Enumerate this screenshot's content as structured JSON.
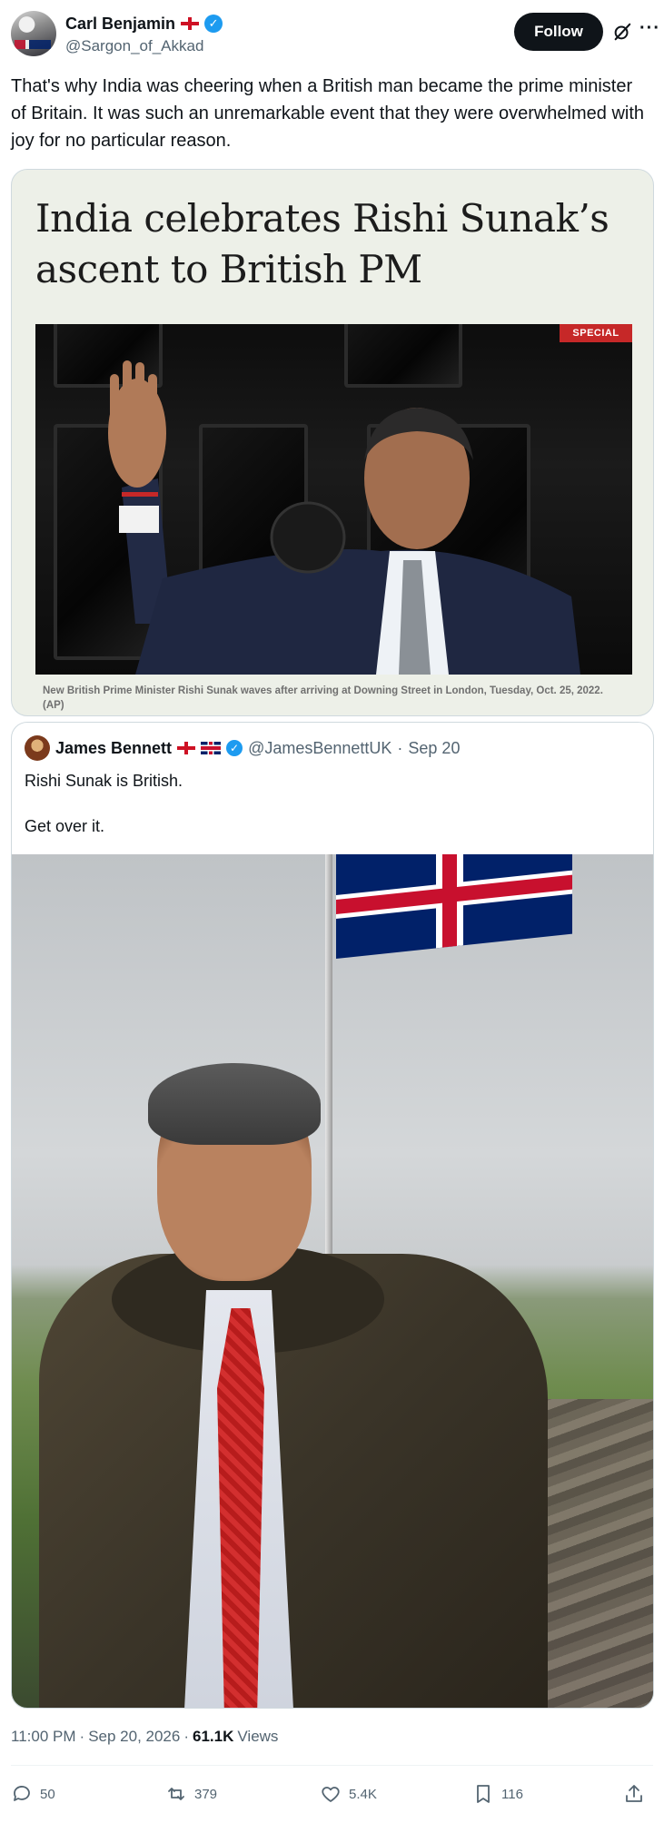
{
  "author": {
    "display_name": "Carl Benjamin",
    "handle": "@Sargon_of_Akkad",
    "verified": true
  },
  "header": {
    "follow_label": "Follow"
  },
  "tweet": {
    "text": "That's why India was cheering when a British man became the prime minister of Britain. It was such an unremarkable event that they were overwhelmed with joy for no particular reason."
  },
  "image_card": {
    "headline": "India celebrates Rishi Sunak’s ascent to British PM",
    "badge": "SPECIAL",
    "caption": "New British Prime Minister Rishi Sunak waves after arriving at Downing Street in London, Tuesday, Oct. 25, 2022. (AP)"
  },
  "quoted_tweet": {
    "display_name": "James Bennett",
    "handle": "@JamesBennettUK",
    "separator": "·",
    "date": "Sep 20",
    "line1": "Rishi Sunak is British.",
    "line2": "Get over it."
  },
  "meta": {
    "time": "11:00 PM",
    "sep1": "·",
    "date": "Sep 20, 2026",
    "sep2": "·",
    "views_count": "61.1K",
    "views_label": "Views"
  },
  "actions": {
    "replies": "50",
    "reposts": "379",
    "likes": "5.4K",
    "bookmarks": "116"
  },
  "colors": {
    "accent": "#1d9bf0",
    "text_primary": "#0f1419",
    "text_secondary": "#536471",
    "badge_red": "#c62828"
  }
}
